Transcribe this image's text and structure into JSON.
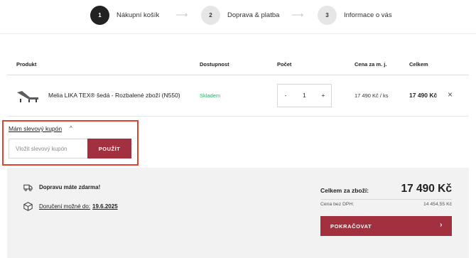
{
  "steps": [
    {
      "number": "1",
      "label": "Nákupní košík"
    },
    {
      "number": "2",
      "label": "Doprava & platba"
    },
    {
      "number": "3",
      "label": "Informace o vás"
    }
  ],
  "table": {
    "headers": {
      "product": "Produkt",
      "availability": "Dostupnost",
      "count": "Počet",
      "unit_price": "Cena za m. j.",
      "total": "Celkem"
    }
  },
  "product": {
    "name": "Melia LIKA TEX® šedá - Rozbalené zboží (N550)",
    "availability": "Skladem",
    "quantity": "1",
    "minus": "-",
    "plus": "+",
    "unit_price": "17 490 Kč / ks",
    "total": "17 490 Kč",
    "remove": "×"
  },
  "coupon": {
    "toggle_label": "Mám slevový kupón",
    "placeholder": "Vložit slevový kupón",
    "apply_label": "POUŽÍT"
  },
  "summary": {
    "free_shipping": "Dopravu máte zdarma!",
    "delivery_label": "Doručení možné do:",
    "delivery_date": "19.6.2025",
    "total_label": "Celkem za zboží:",
    "total_value": "17 490 Kč",
    "vat_label": "Cena bez DPH:",
    "vat_value": "14 454,55 Kč",
    "continue_label": "POKRAČOVAT"
  },
  "colors": {
    "accent": "#a3303e",
    "stock": "#3aa76d",
    "highlight": "#e0442c"
  }
}
